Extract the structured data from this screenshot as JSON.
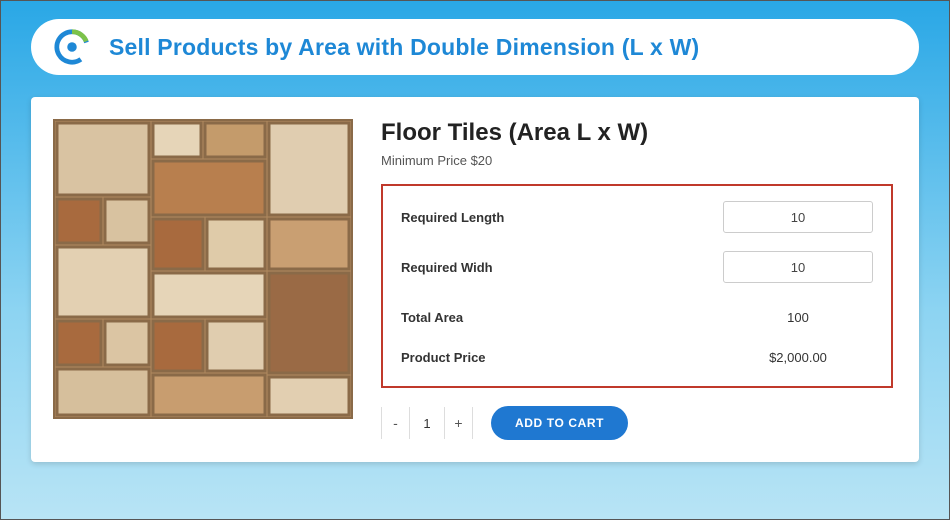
{
  "header": {
    "title": "Sell Products by Area with Double Dimension (L x W)"
  },
  "product": {
    "title": "Floor Tiles (Area L x W)",
    "minimum_price_label": "Minimum Price $20"
  },
  "calculator": {
    "length_label": "Required Length",
    "length_value": "10",
    "width_label": "Required Widh",
    "width_value": "10",
    "total_area_label": "Total Area",
    "total_area_value": "100",
    "price_label": "Product Price",
    "price_value": "$2,000.00"
  },
  "actions": {
    "qty_minus": "-",
    "qty_value": "1",
    "qty_plus": "+",
    "add_to_cart": "ADD TO CART"
  }
}
